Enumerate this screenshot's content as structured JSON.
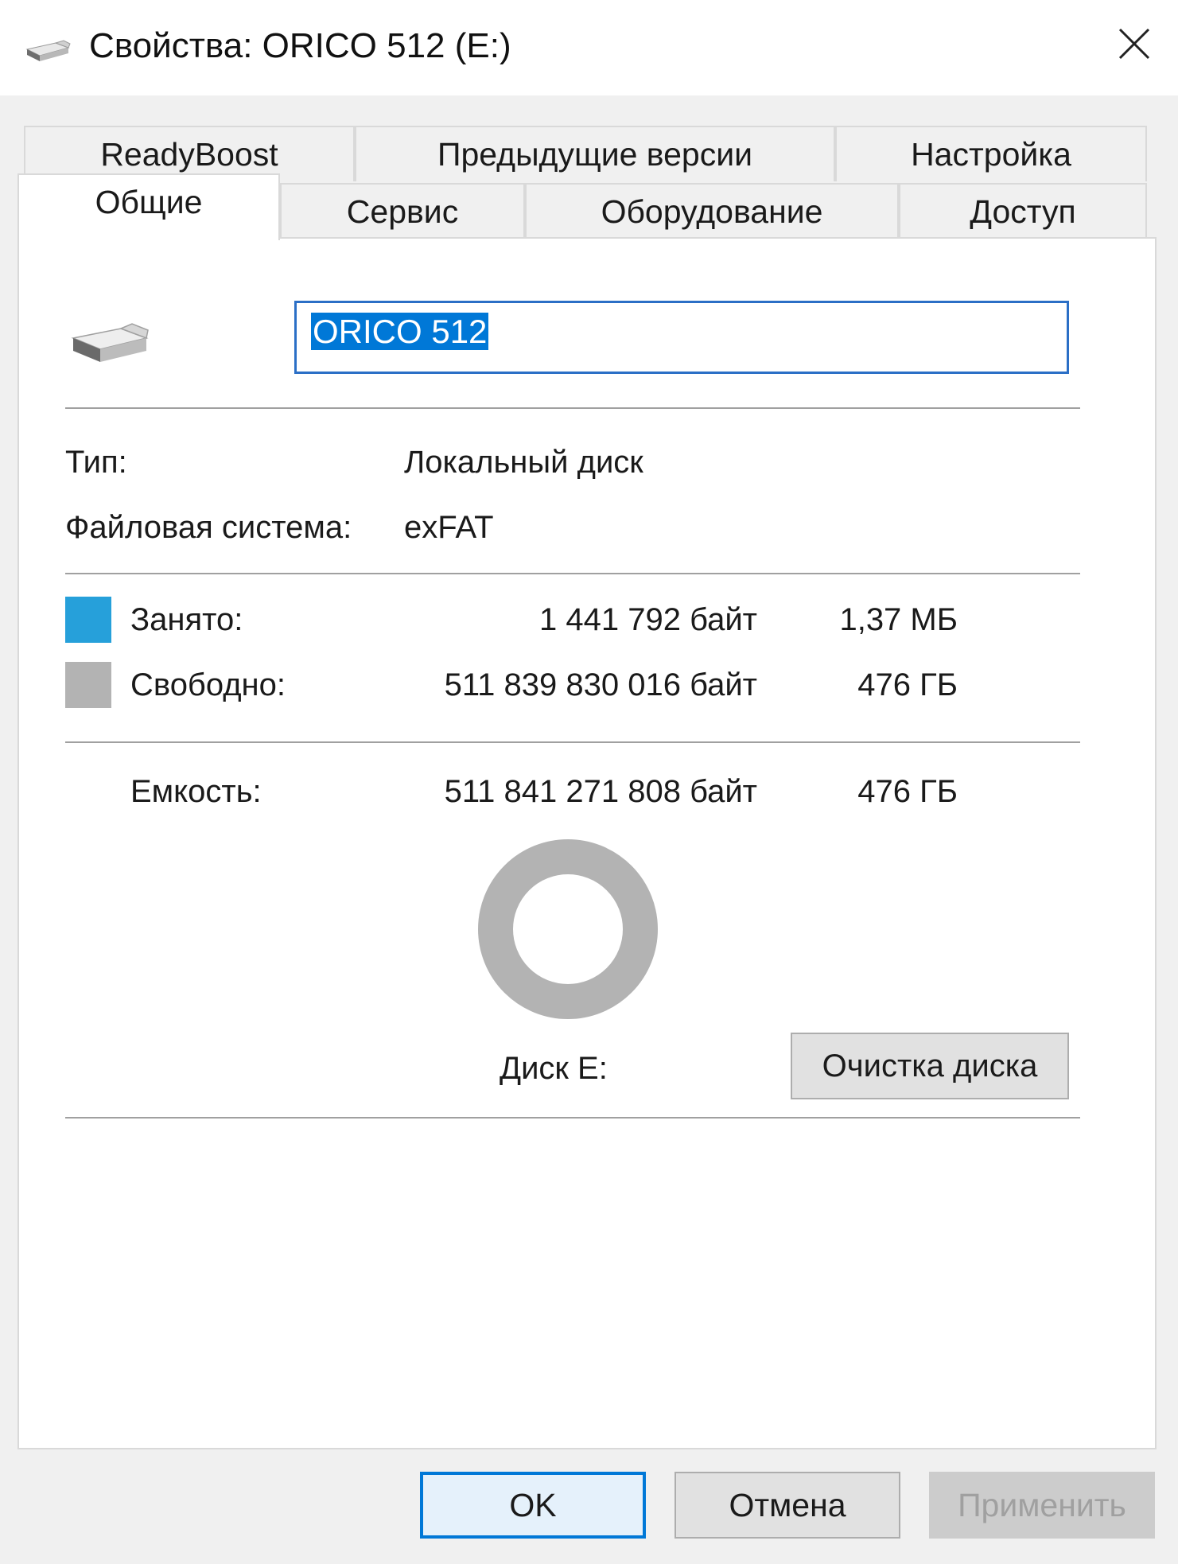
{
  "window": {
    "title": "Свойства: ORICO 512 (E:)"
  },
  "tabs_row1": [
    {
      "label": "ReadyBoost"
    },
    {
      "label": "Предыдущие версии"
    },
    {
      "label": "Настройка"
    }
  ],
  "tabs_row2": [
    {
      "label": "Общие",
      "active": true
    },
    {
      "label": "Сервис"
    },
    {
      "label": "Оборудование"
    },
    {
      "label": "Доступ"
    }
  ],
  "general": {
    "drive_name": "ORICO 512",
    "type_label": "Тип:",
    "type_value": "Локальный диск",
    "fs_label": "Файловая система:",
    "fs_value": "exFAT",
    "used": {
      "label": "Занято:",
      "bytes": "1 441 792 байт",
      "size": "1,37 МБ",
      "color": "#26a0da"
    },
    "free": {
      "label": "Свободно:",
      "bytes": "511 839 830 016 байт",
      "size": "476 ГБ",
      "color": "#b3b3b3"
    },
    "capacity": {
      "label": "Емкость:",
      "bytes": "511 841 271 808 байт",
      "size": "476 ГБ"
    },
    "used_fraction": 2.8e-06,
    "disk_label": "Диск E:",
    "cleanup_label": "Очистка диска"
  },
  "buttons": {
    "ok": "OK",
    "cancel": "Отмена",
    "apply": "Применить"
  },
  "icons": {
    "title": "usb-drive-icon",
    "drive": "usb-drive-icon",
    "close": "close-icon"
  }
}
